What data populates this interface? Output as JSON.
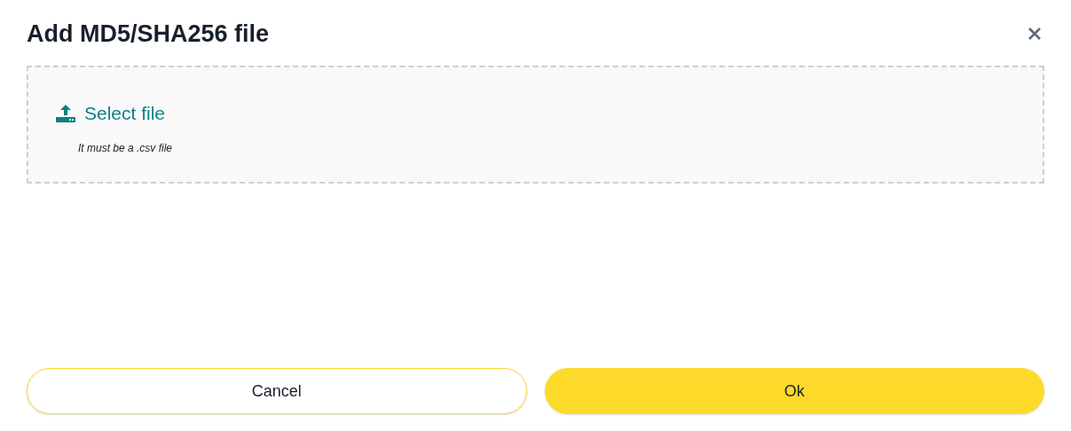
{
  "dialog": {
    "title": "Add MD5/SHA256 file"
  },
  "upload": {
    "label": "Select file",
    "hint": "It must be a .csv file"
  },
  "buttons": [
    {
      "label": "Cancel",
      "kind": "secondary"
    },
    {
      "label": "Ok",
      "kind": "primary"
    }
  ]
}
